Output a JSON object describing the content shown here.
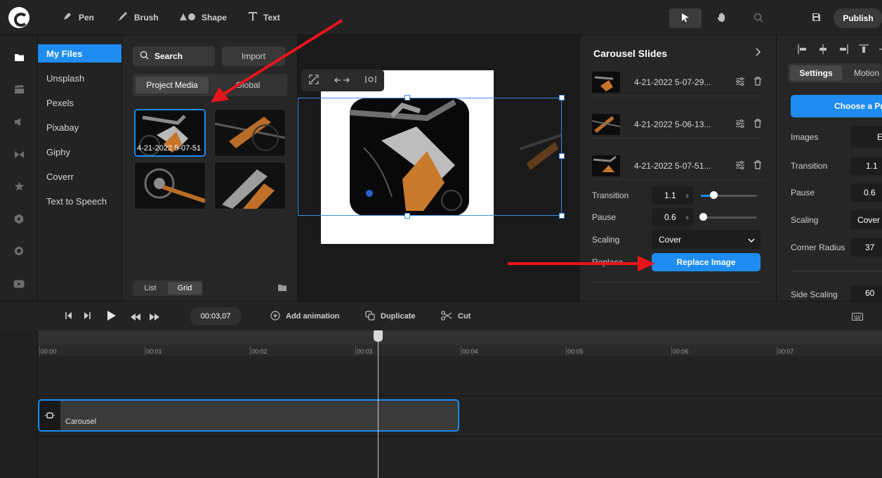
{
  "topbar": {
    "tools": [
      {
        "label": "Pen",
        "icon": "pen-icon"
      },
      {
        "label": "Brush",
        "icon": "brush-icon"
      },
      {
        "label": "Shape",
        "icon": "shape-icon"
      },
      {
        "label": "Text",
        "icon": "text-icon"
      }
    ],
    "publish_label": "Publish"
  },
  "sources": {
    "items": [
      "My Files",
      "Unsplash",
      "Pexels",
      "Pixabay",
      "Giphy",
      "Coverr",
      "Text to Speech"
    ],
    "active_index": 0
  },
  "media": {
    "search_label": "Search",
    "import_label": "Import",
    "tabs": [
      "Project Media",
      "Global"
    ],
    "active_tab": 0,
    "thumb_label": "4-21-2022 5-07-51",
    "view_modes": [
      "List",
      "Grid"
    ],
    "active_view": 1
  },
  "slides_panel": {
    "title": "Carousel Slides",
    "slides": [
      {
        "name": "4-21-2022 5-07-29..."
      },
      {
        "name": "4-21-2022 5-06-13..."
      },
      {
        "name": "4-21-2022 5-07-51..."
      }
    ],
    "transition_label": "Transition",
    "transition_value": "1.1",
    "transition_unit": "s",
    "transition_level": 0.22,
    "pause_label": "Pause",
    "pause_value": "0.6",
    "pause_unit": "s",
    "pause_level": 0.04,
    "scaling_label": "Scaling",
    "scaling_value": "Cover",
    "replace_label": "Replace",
    "replace_button": "Replace Image"
  },
  "settings_panel": {
    "tabs": [
      "Settings",
      "Motion"
    ],
    "active_tab": 0,
    "choose_button": "Choose a Pr",
    "images_label": "Images",
    "images_value": "E",
    "transition_label": "Transition",
    "transition_value": "1.1",
    "pause_label": "Pause",
    "pause_value": "0.6",
    "scaling_label": "Scaling",
    "scaling_value": "Cover",
    "corner_radius_label": "Corner Radius",
    "corner_radius_value": "37",
    "side_scaling_label": "Side Scaling",
    "side_scaling_value": "60"
  },
  "timeline": {
    "current_time": "00:03,07",
    "actions": [
      {
        "label": "Add animation",
        "icon": "plus-circle-icon"
      },
      {
        "label": "Duplicate",
        "icon": "duplicate-icon"
      },
      {
        "label": "Cut",
        "icon": "scissors-icon"
      }
    ],
    "ruler_labels": [
      "00:00",
      "00:01",
      "00:02",
      "00:03",
      "00:04",
      "00:05",
      "00:06",
      "00:07"
    ],
    "clip_label": "Carousel"
  },
  "colors": {
    "accent": "#1e8cf0",
    "annotation_arrow": "#e8141b",
    "background": "#1b1b1b"
  }
}
